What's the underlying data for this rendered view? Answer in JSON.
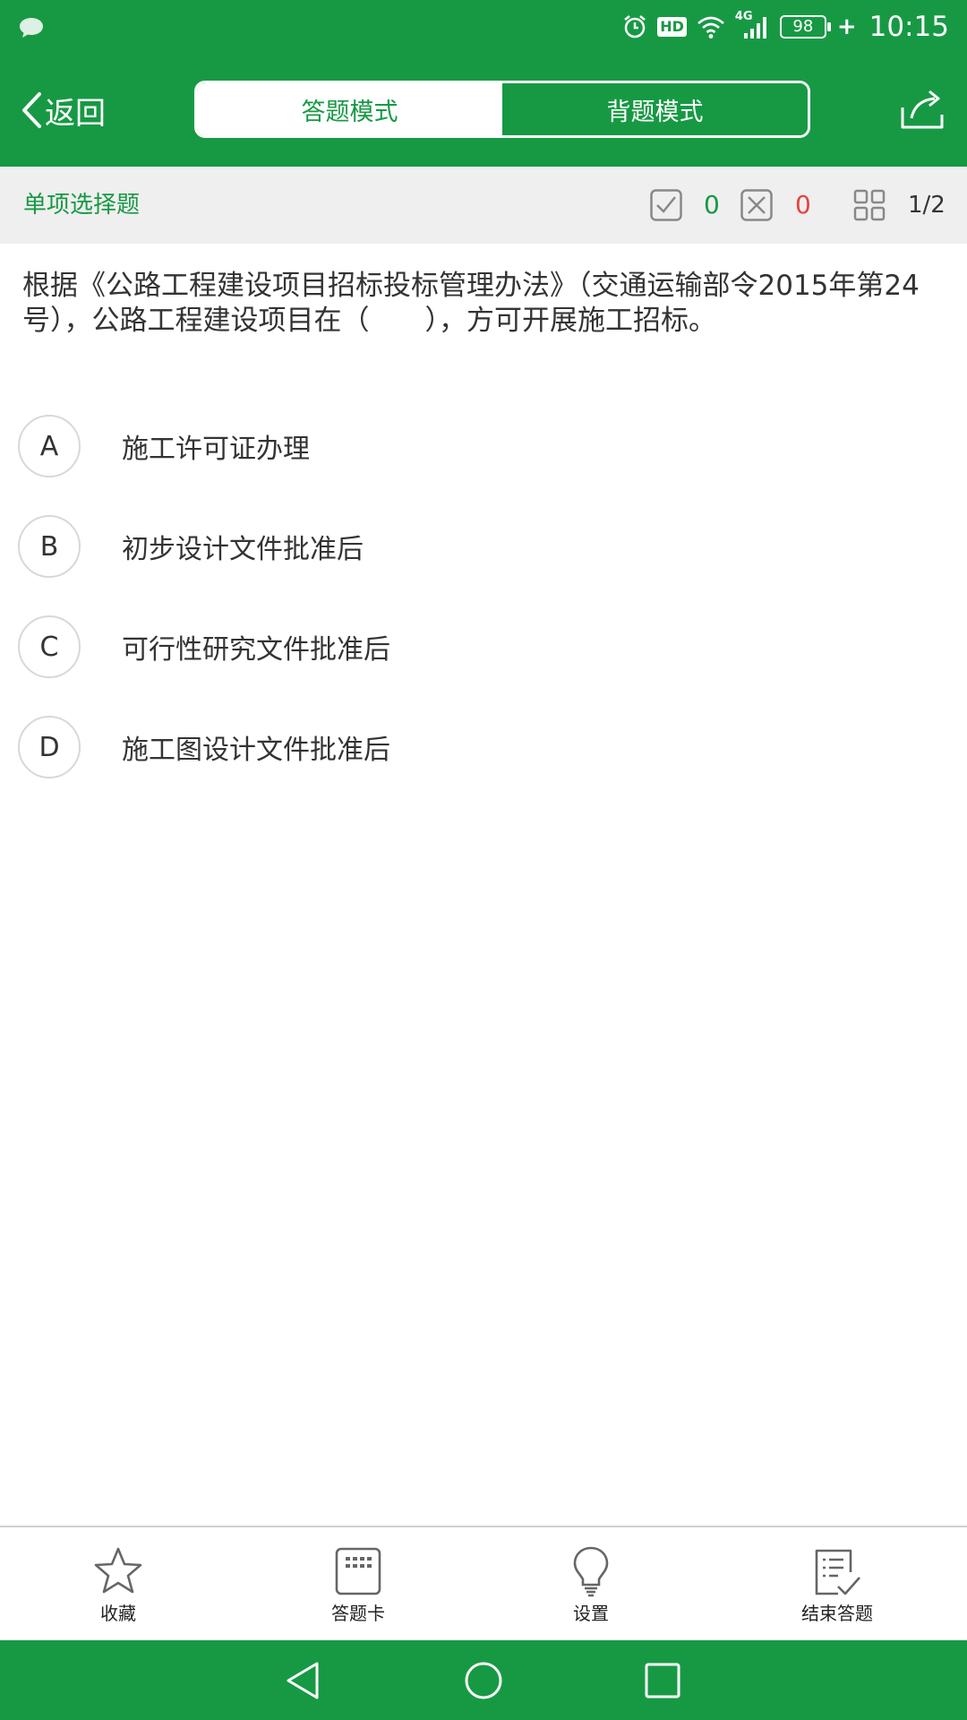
{
  "status_bar": {
    "notification_icon": "chat-bubble-icon",
    "icons": [
      "alarm-icon",
      "hd-icon",
      "wifi-icon",
      "signal-4g-icon"
    ],
    "hd_label": "HD",
    "network_label": "4G",
    "battery": "98",
    "charging_symbol": "+",
    "time": "10:15"
  },
  "nav": {
    "back_label": "返回",
    "tabs": [
      {
        "label": "答题模式",
        "active": true
      },
      {
        "label": "背题模式",
        "active": false
      }
    ],
    "share_icon": "share-icon"
  },
  "info_bar": {
    "question_type": "单项选择题",
    "correct_count": "0",
    "wrong_count": "0",
    "progress": "1/2"
  },
  "question": {
    "text": "根据《公路工程建设项目招标投标管理办法》（交通运输部令2015年第24号），公路工程建设项目在（　　），方可开展施工招标。",
    "options": [
      {
        "letter": "A",
        "text": "施工许可证办理"
      },
      {
        "letter": "B",
        "text": "初步设计文件批准后"
      },
      {
        "letter": "C",
        "text": "可行性研究文件批准后"
      },
      {
        "letter": "D",
        "text": "施工图设计文件批准后"
      }
    ]
  },
  "toolbar": {
    "items": [
      {
        "label": "收藏",
        "icon": "star-icon"
      },
      {
        "label": "答题卡",
        "icon": "answer-card-icon"
      },
      {
        "label": "设置",
        "icon": "lightbulb-icon"
      },
      {
        "label": "结束答题",
        "icon": "finish-list-icon"
      }
    ]
  },
  "colors": {
    "brand_green": "#179944",
    "wrong_red": "#e64340",
    "info_bar_bg": "#efefef"
  }
}
